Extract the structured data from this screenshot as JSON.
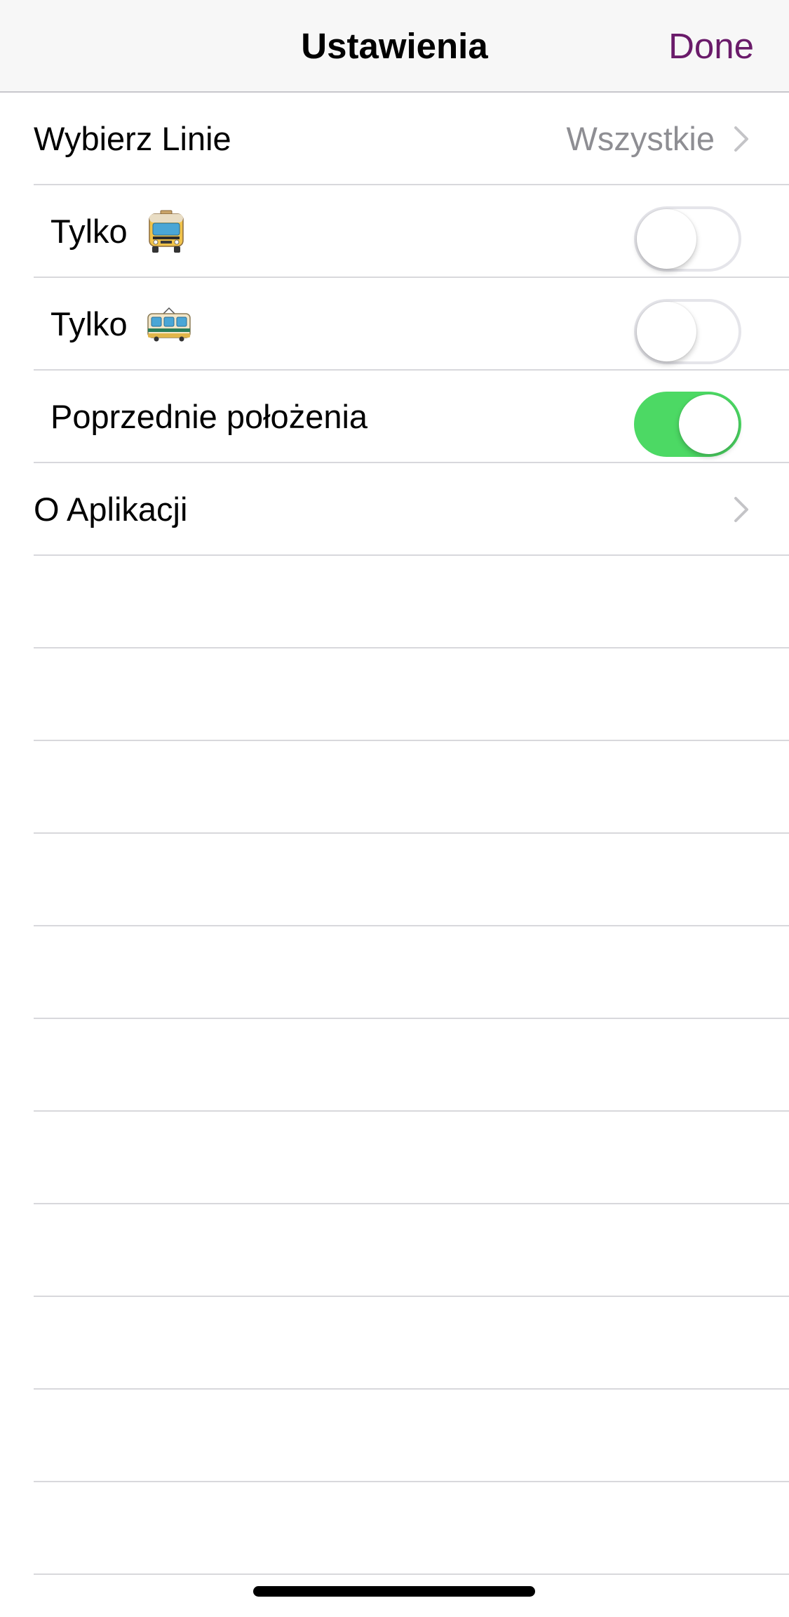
{
  "navbar": {
    "title": "Ustawienia",
    "done_label": "Done"
  },
  "rows": {
    "lines": {
      "label": "Wybierz Linie",
      "value": "Wszystkie"
    },
    "bus_only": {
      "label": "Tylko",
      "emoji": "bus-front-icon",
      "toggle_on": false
    },
    "tram_only": {
      "label": "Tylko",
      "emoji": "tram-icon",
      "toggle_on": false
    },
    "previous_positions": {
      "label": "Poprzednie położenia",
      "toggle_on": true
    },
    "about": {
      "label": "O Aplikacji"
    }
  },
  "colors": {
    "accent": "#6a1b6a",
    "toggle_on": "#4cd964",
    "secondary_text": "#8e8e93",
    "separator": "#d8d8dc"
  }
}
